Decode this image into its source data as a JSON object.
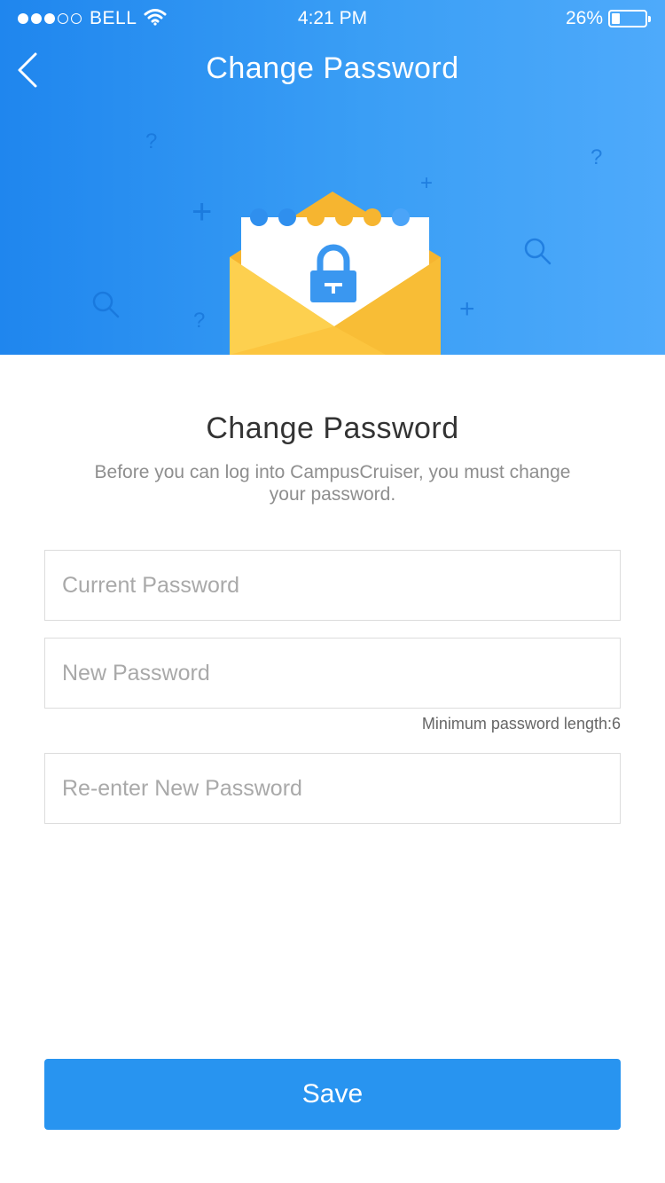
{
  "status_bar": {
    "carrier": "BELL",
    "time": "4:21 PM",
    "battery": "26%"
  },
  "nav": {
    "title": "Change Password",
    "back_icon": "chevron-left-icon"
  },
  "decorations": {
    "question_mark": "?",
    "plus": "+"
  },
  "content": {
    "title": "Change Password",
    "subtitle": "Before you can log into CampusCruiser, you must change your password."
  },
  "form": {
    "current_password": {
      "placeholder": "Current Password",
      "value": ""
    },
    "new_password": {
      "placeholder": "New Password",
      "value": ""
    },
    "new_password_hint": "Minimum password length:6",
    "confirm_password": {
      "placeholder": "Re-enter New Password",
      "value": ""
    },
    "save_label": "Save"
  },
  "colors": {
    "primary": "#2894f0",
    "envelope": "#fcc53f",
    "lock": "#3a97f0"
  }
}
